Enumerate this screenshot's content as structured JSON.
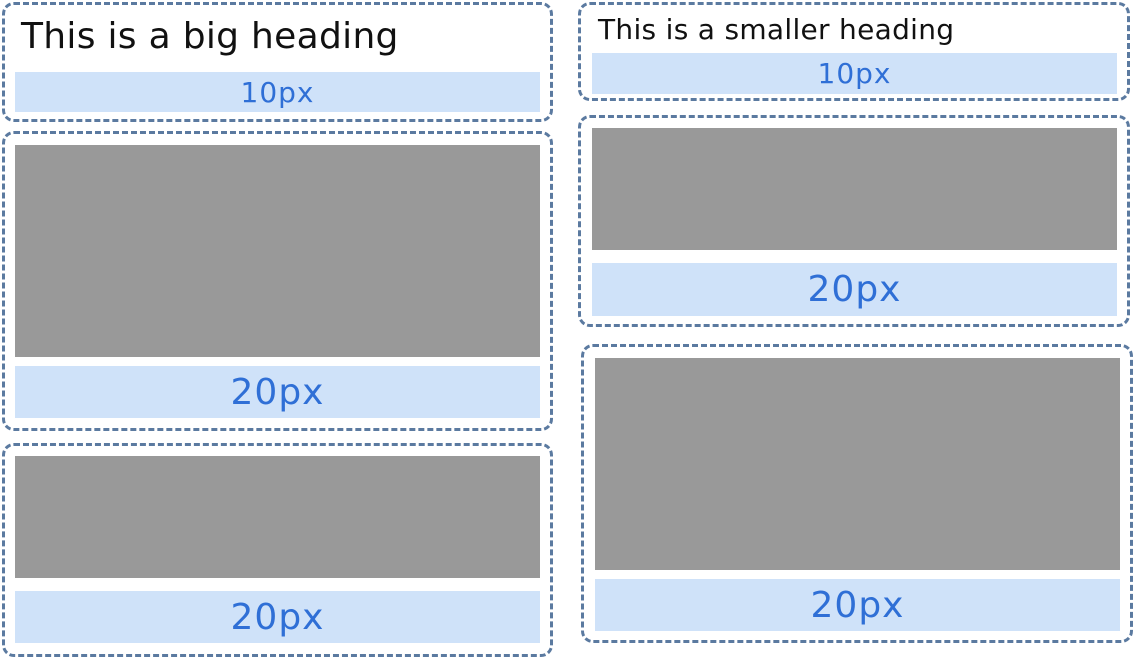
{
  "colors": {
    "border": "#5b7aa0",
    "spacer_bg": "#cfe2f9",
    "spacer_text": "#2f6fd6",
    "placeholder": "#999999",
    "heading_text": "#111111"
  },
  "left": {
    "heading": "This is a big heading",
    "heading_spacer": "10px",
    "block1_spacer": "20px",
    "block2_spacer": "20px"
  },
  "right": {
    "heading": "This is a smaller heading",
    "heading_spacer": "10px",
    "block1_spacer": "20px",
    "block2_spacer": "20px"
  }
}
